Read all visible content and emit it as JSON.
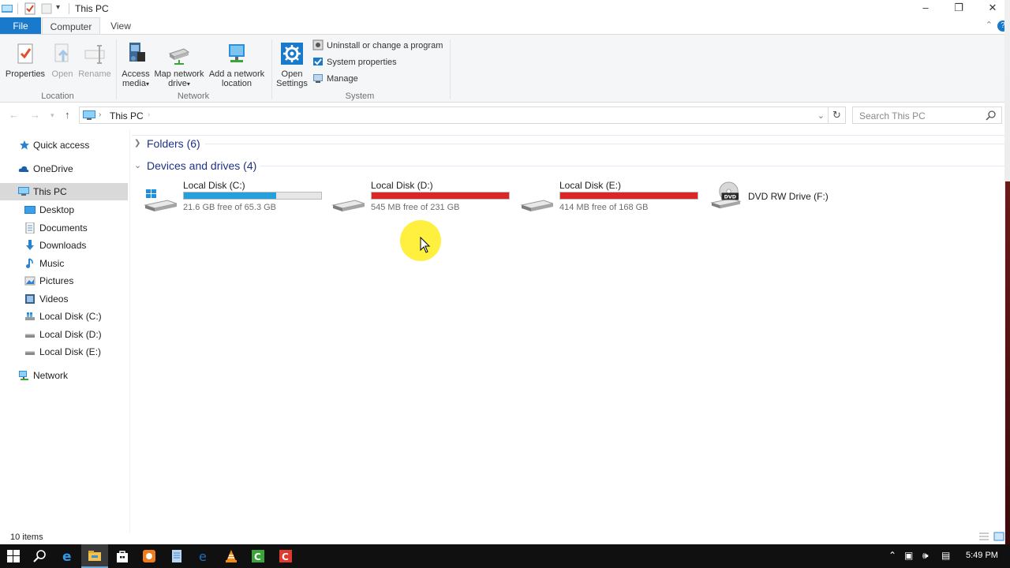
{
  "window": {
    "title": "This PC",
    "controls": {
      "minimize": "–",
      "maximize": "❐",
      "close": "✕"
    }
  },
  "ribbon": {
    "tabs": {
      "file": "File",
      "computer": "Computer",
      "view": "View"
    },
    "location": {
      "group_label": "Location",
      "properties": "Properties",
      "open": "Open",
      "rename": "Rename"
    },
    "network": {
      "group_label": "Network",
      "access_media": "Access media",
      "map_network_drive": "Map network drive",
      "add_network_location": "Add a network location"
    },
    "system": {
      "group_label": "System",
      "open_settings": "Open Settings",
      "uninstall": "Uninstall or change a program",
      "system_properties": "System properties",
      "manage": "Manage"
    }
  },
  "address": {
    "path": "This PC",
    "search_placeholder": "Search This PC"
  },
  "nav_pane": {
    "items": [
      {
        "label": "Quick access",
        "icon": "star-icon"
      },
      {
        "label": "OneDrive",
        "icon": "cloud-icon"
      },
      {
        "label": "This PC",
        "icon": "computer-icon",
        "selected": true
      },
      {
        "label": "Desktop",
        "icon": "desktop-folder-icon"
      },
      {
        "label": "Documents",
        "icon": "documents-icon"
      },
      {
        "label": "Downloads",
        "icon": "download-icon"
      },
      {
        "label": "Music",
        "icon": "music-icon"
      },
      {
        "label": "Pictures",
        "icon": "pictures-icon"
      },
      {
        "label": "Videos",
        "icon": "videos-icon"
      },
      {
        "label": "Local Disk (C:)",
        "icon": "drive-icon"
      },
      {
        "label": "Local Disk (D:)",
        "icon": "drive-icon"
      },
      {
        "label": "Local Disk (E:)",
        "icon": "drive-icon"
      },
      {
        "label": "Network",
        "icon": "network-icon"
      }
    ]
  },
  "content": {
    "folders_header": "Folders (6)",
    "devices_header": "Devices and drives (4)",
    "drives": [
      {
        "name": "Local Disk (C:)",
        "info": "21.6 GB free of 65.3 GB",
        "used_fraction": 0.67,
        "color": "#26a0da"
      },
      {
        "name": "Local Disk (D:)",
        "info": "545 MB free of 231 GB",
        "used_fraction": 0.998,
        "color": "#da2626"
      },
      {
        "name": "Local Disk (E:)",
        "info": "414 MB free of 168 GB",
        "used_fraction": 0.998,
        "color": "#da2626"
      },
      {
        "name": "DVD RW Drive (F:)",
        "dvd_label": "DVD"
      }
    ]
  },
  "status": {
    "items_count": "10 items"
  },
  "taskbar": {
    "clock": "5:49 PM"
  },
  "colors": {
    "accent": "#1979ca",
    "selected_bg": "#d9d9d9",
    "low_space": "#da2626",
    "normal_space": "#26a0da"
  }
}
